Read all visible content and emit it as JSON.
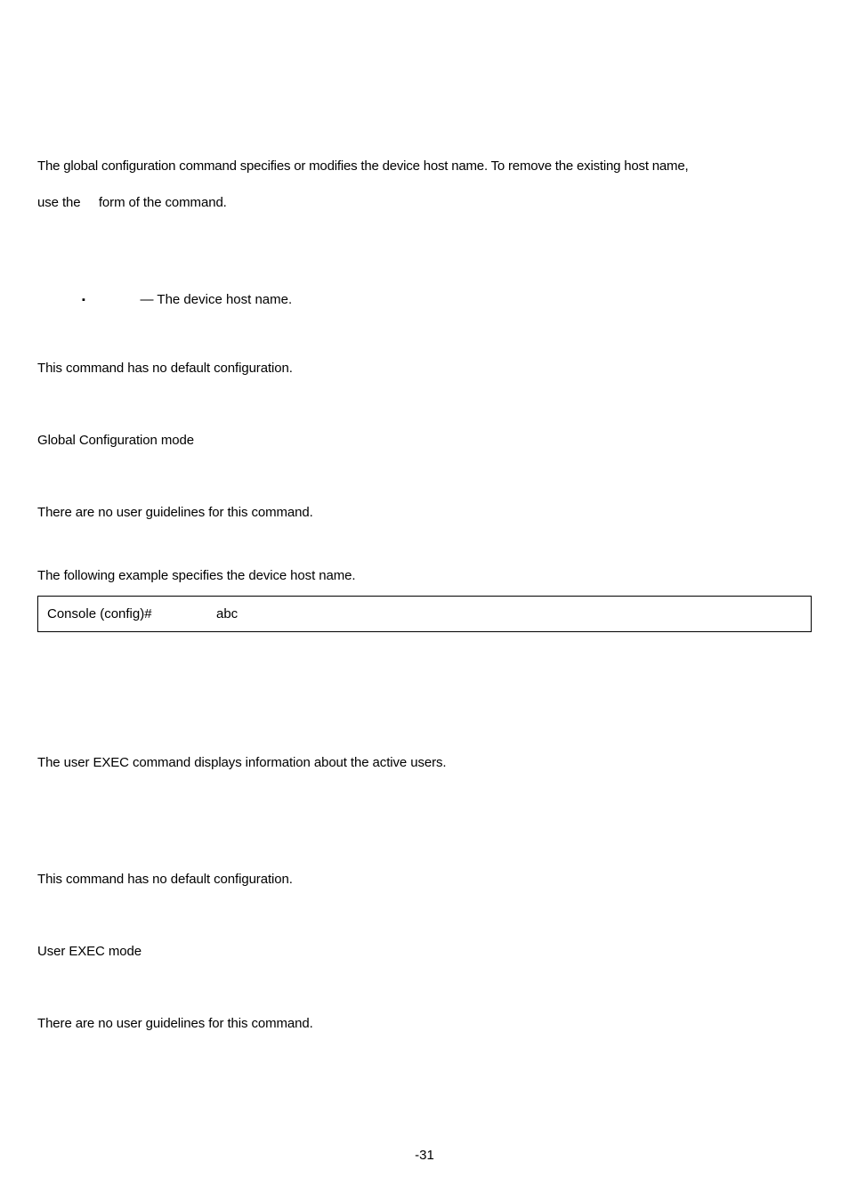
{
  "section1": {
    "para_line1": "The               global configuration command specifies or modifies the device host name. To remove the existing host name,",
    "para_line2_a": "use the",
    "para_line2_b": "form of the command.",
    "bullet1": " — The device host name.",
    "default_cfg": "This command has no default configuration.",
    "mode": "Global Configuration mode",
    "guidelines": "There are no user guidelines for this command.",
    "example_intro": "The following example specifies the device host name.",
    "code_prompt": "Console (config)#",
    "code_arg": "abc"
  },
  "section2": {
    "para": "The                   user EXEC command displays information about the active users.",
    "default_cfg": "This command has no default configuration.",
    "mode": "User EXEC mode",
    "guidelines": "There are no user guidelines for this command."
  },
  "footer": {
    "page": "-31"
  }
}
